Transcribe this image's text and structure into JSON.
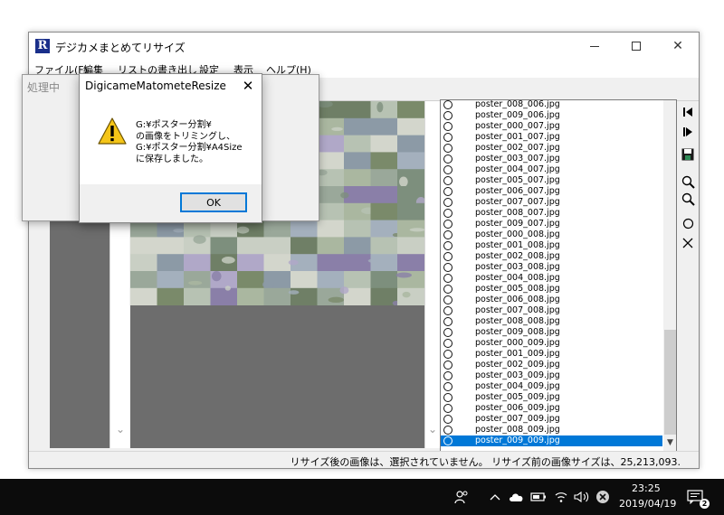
{
  "window": {
    "title": "デジカメまとめてリサイズ",
    "logo_letter": "R"
  },
  "menu": [
    "ファイル(F)",
    "編集",
    "リストの書き出し",
    "設定",
    "表示",
    "ヘルプ(H)"
  ],
  "processing_window": {
    "title": "処理中"
  },
  "message_box": {
    "title": "DigicameMatometeResize",
    "lines": [
      "G:¥ポスター分割¥",
      "の画像をトリミングし、",
      "G:¥ポスター分割¥A4Size",
      "に保存しました。"
    ],
    "ok_label": "OK"
  },
  "file_list": {
    "items": [
      "poster_008_006.jpg",
      "poster_009_006.jpg",
      "poster_000_007.jpg",
      "poster_001_007.jpg",
      "poster_002_007.jpg",
      "poster_003_007.jpg",
      "poster_004_007.jpg",
      "poster_005_007.jpg",
      "poster_006_007.jpg",
      "poster_007_007.jpg",
      "poster_008_007.jpg",
      "poster_009_007.jpg",
      "poster_000_008.jpg",
      "poster_001_008.jpg",
      "poster_002_008.jpg",
      "poster_003_008.jpg",
      "poster_004_008.jpg",
      "poster_005_008.jpg",
      "poster_006_008.jpg",
      "poster_007_008.jpg",
      "poster_008_008.jpg",
      "poster_009_008.jpg",
      "poster_000_009.jpg",
      "poster_001_009.jpg",
      "poster_002_009.jpg",
      "poster_003_009.jpg",
      "poster_004_009.jpg",
      "poster_005_009.jpg",
      "poster_006_009.jpg",
      "poster_007_009.jpg",
      "poster_008_009.jpg",
      "poster_009_009.jpg"
    ],
    "selected": "poster_009_009.jpg"
  },
  "toolbar_icons": [
    "step-back-icon",
    "step-forward-icon",
    "save-icon",
    "zoom-in-icon",
    "zoom-out-icon",
    "circle-icon",
    "cross-icon"
  ],
  "status": {
    "text": "リサイズ後の画像は、選択されていません。 リサイズ前の画像サイズは、25,213,093."
  },
  "taskbar": {
    "time": "23:25",
    "date": "2019/04/19",
    "notification_count": "2"
  },
  "colors": {
    "selection": "#0078d7",
    "taskbar": "#0c0c0c",
    "logo": "#1a2f8a"
  }
}
